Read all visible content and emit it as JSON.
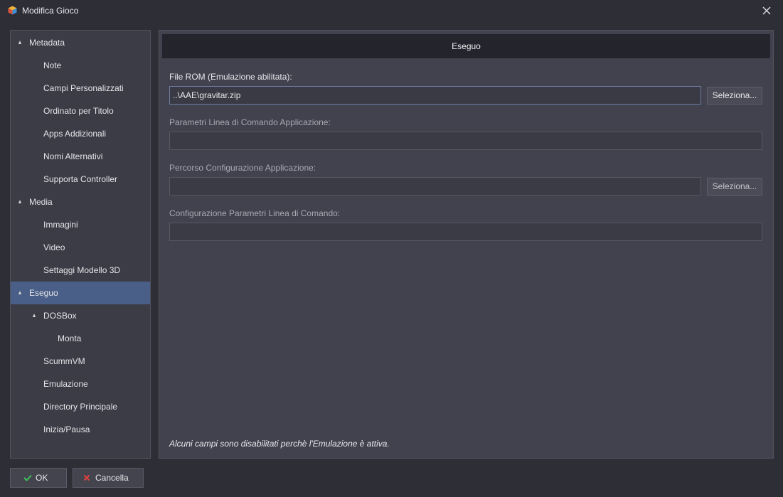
{
  "window": {
    "title": "Modifica Gioco"
  },
  "tree": {
    "items": [
      {
        "label": "Metadata",
        "level": 0,
        "expanded": true,
        "selected": false
      },
      {
        "label": "Note",
        "level": 1,
        "expanded": false,
        "selected": false
      },
      {
        "label": "Campi Personalizzati",
        "level": 1,
        "expanded": false,
        "selected": false
      },
      {
        "label": "Ordinato per Titolo",
        "level": 1,
        "expanded": false,
        "selected": false
      },
      {
        "label": "Apps Addizionali",
        "level": 1,
        "expanded": false,
        "selected": false
      },
      {
        "label": "Nomi Alternativi",
        "level": 1,
        "expanded": false,
        "selected": false
      },
      {
        "label": "Supporta Controller",
        "level": 1,
        "expanded": false,
        "selected": false
      },
      {
        "label": "Media",
        "level": 0,
        "expanded": true,
        "selected": false
      },
      {
        "label": "Immagini",
        "level": 1,
        "expanded": false,
        "selected": false
      },
      {
        "label": "Video",
        "level": 1,
        "expanded": false,
        "selected": false
      },
      {
        "label": "Settaggi Modello 3D",
        "level": 1,
        "expanded": false,
        "selected": false
      },
      {
        "label": "Eseguo",
        "level": 0,
        "expanded": true,
        "selected": true
      },
      {
        "label": "DOSBox",
        "level": 1,
        "expanded": true,
        "selected": false
      },
      {
        "label": "Monta",
        "level": 2,
        "expanded": false,
        "selected": false
      },
      {
        "label": "ScummVM",
        "level": 1,
        "expanded": false,
        "selected": false
      },
      {
        "label": "Emulazione",
        "level": 1,
        "expanded": false,
        "selected": false
      },
      {
        "label": "Directory Principale",
        "level": 1,
        "expanded": false,
        "selected": false
      },
      {
        "label": "Inizia/Pausa",
        "level": 1,
        "expanded": false,
        "selected": false
      }
    ]
  },
  "panel": {
    "header": "Eseguo",
    "rom_label": "File ROM (Emulazione abilitata):",
    "rom_value": "..\\AAE\\gravitar.zip",
    "browse_label": "Seleziona...",
    "cmdline_label": "Parametri Linea di Comando Applicazione:",
    "cmdline_value": "",
    "config_path_label": "Percorso Configurazione Applicazione:",
    "config_path_value": "",
    "config_params_label": "Configurazione Parametri Linea di Comando:",
    "config_params_value": "",
    "footnote": "Alcuni campi sono disabilitati perchè l'Emulazione è attiva."
  },
  "buttons": {
    "ok_label": "OK",
    "cancel_label": "Cancella"
  },
  "colors": {
    "selection": "#4a5f87",
    "background": "#2d2e36",
    "panel": "#41424e",
    "ok_icon": "#3fc256",
    "cancel_icon": "#e0403a"
  },
  "icons": {
    "app": "game-box-icon",
    "close": "close-icon",
    "expand": "triangle-expanded-icon",
    "ok": "check-icon",
    "cancel": "x-icon"
  }
}
